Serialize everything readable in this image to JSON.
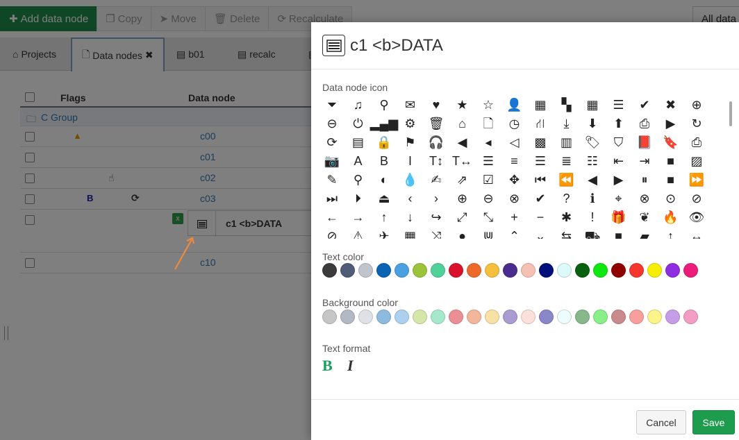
{
  "toolbar": {
    "add": "Add data node",
    "copy": "Copy",
    "move": "Move",
    "delete": "Delete",
    "recalculate": "Recalculate",
    "all_data": "All data"
  },
  "tabs": {
    "projects": "Projects",
    "data_nodes": "Data nodes",
    "b01": "b01",
    "recalc": "recalc"
  },
  "grid": {
    "col_flags": "Flags",
    "col_data_node": "Data node",
    "group": "C Group",
    "rows": [
      {
        "name": "c00"
      },
      {
        "name": "c01"
      },
      {
        "name": "c02"
      },
      {
        "name": "c03"
      },
      {
        "name": "c10"
      }
    ],
    "flag_bold": "B",
    "inline_edit_value": "c1 <b>DATA"
  },
  "dialog": {
    "title": "c1 <b>DATA",
    "icon_label": "Data node icon",
    "text_color_label": "Text color",
    "bg_color_label": "Background color",
    "text_format_label": "Text format",
    "bold_glyph": "B",
    "italic_glyph": "I",
    "cancel": "Cancel",
    "save": "Save"
  },
  "icons": [
    [
      "filter-icon",
      "music-icon",
      "search-icon",
      "envelope-icon",
      "heart-icon",
      "star-icon",
      "star-outline-icon",
      "user-icon",
      "film-icon",
      "th-large-icon",
      "th-icon",
      "th-list-icon",
      "check-icon",
      "times-icon",
      "zoom-in-icon"
    ],
    [
      "zoom-out-icon",
      "power-icon",
      "signal-icon",
      "cog-icon",
      "trash-icon",
      "home-icon",
      "file-icon",
      "clock-icon",
      "road-icon",
      "download-icon",
      "arrow-circle-down-icon",
      "arrow-circle-up-icon",
      "inbox-icon",
      "play-circle-icon",
      "repeat-icon"
    ],
    [
      "refresh-icon",
      "list-alt-icon",
      "lock-icon",
      "flag-icon",
      "headphones-icon",
      "volume-off-icon",
      "volume-down-icon",
      "volume-up-icon",
      "qrcode-icon",
      "barcode-icon",
      "tag-icon",
      "tags-icon",
      "book-icon",
      "bookmark-icon",
      "print-icon"
    ],
    [
      "camera-icon",
      "font-icon",
      "bold-icon",
      "italic-icon",
      "text-height-icon",
      "text-width-icon",
      "align-left-icon",
      "align-center-icon",
      "align-right-icon",
      "align-justify-icon",
      "list-icon",
      "outdent-icon",
      "indent-icon",
      "video-icon",
      "picture-icon"
    ],
    [
      "pencil-icon",
      "map-marker-icon",
      "adjust-icon",
      "tint-icon",
      "edit-icon",
      "share-icon",
      "check-square-icon",
      "move-icon",
      "step-backward-icon",
      "fast-backward-icon",
      "backward-icon",
      "play-icon",
      "pause-icon",
      "stop-icon",
      "forward-icon"
    ],
    [
      "fast-forward-icon",
      "step-forward-icon",
      "eject-icon",
      "chevron-left-icon",
      "chevron-right-icon",
      "plus-circle-icon",
      "minus-circle-icon",
      "times-circle-icon",
      "check-circle-icon",
      "question-circle-icon",
      "info-circle-icon",
      "crosshairs-icon",
      "times-circle-outline-icon",
      "check-circle-outline-icon",
      "ban-icon"
    ],
    [
      "arrow-left-icon",
      "arrow-right-icon",
      "arrow-up-icon",
      "arrow-down-icon",
      "share-arrow-icon",
      "expand-icon",
      "compress-icon",
      "plus-icon",
      "minus-icon",
      "asterisk-icon",
      "exclamation-circle-icon",
      "gift-icon",
      "leaf-icon",
      "fire-icon",
      "eye-icon"
    ],
    [
      "eye-slash-icon",
      "warning-icon",
      "plane-icon",
      "calendar-icon",
      "random-icon",
      "comment-icon",
      "magnet-icon",
      "chevron-up-icon",
      "chevron-down-icon",
      "retweet-icon",
      "shopping-cart-icon",
      "folder-icon",
      "folder-open-icon",
      "resize-vertical-icon",
      "resize-horizontal-icon"
    ]
  ],
  "text_colors": [
    "#3b3b3b",
    "#4f5d78",
    "#c0c4cc",
    "#0a63b3",
    "#4aa0e0",
    "#9cc43a",
    "#4fd19a",
    "#d9112b",
    "#ee6a2a",
    "#f4c03e",
    "#4a2c8f",
    "#f6c0b3",
    "#00107a",
    "#dcfaf9",
    "#09600e",
    "#0ee80e",
    "#8f0000",
    "#f5372e",
    "#f7ee06",
    "#8e2de2",
    "#ec1c7a"
  ],
  "bg_colors": [
    "#c6c6c6",
    "#b3b9c4",
    "#dfe1e6",
    "#8fbadf",
    "#acd0ef",
    "#d6e6a8",
    "#a6e8cb",
    "#eb8e96",
    "#f3b69a",
    "#f7e1a4",
    "#a89cd0",
    "#fbe1da",
    "#8987c8",
    "#edfcfc",
    "#87b78a",
    "#89ef89",
    "#c88a8a",
    "#f99f9b",
    "#faf48a",
    "#c59de9",
    "#f39cc4"
  ]
}
